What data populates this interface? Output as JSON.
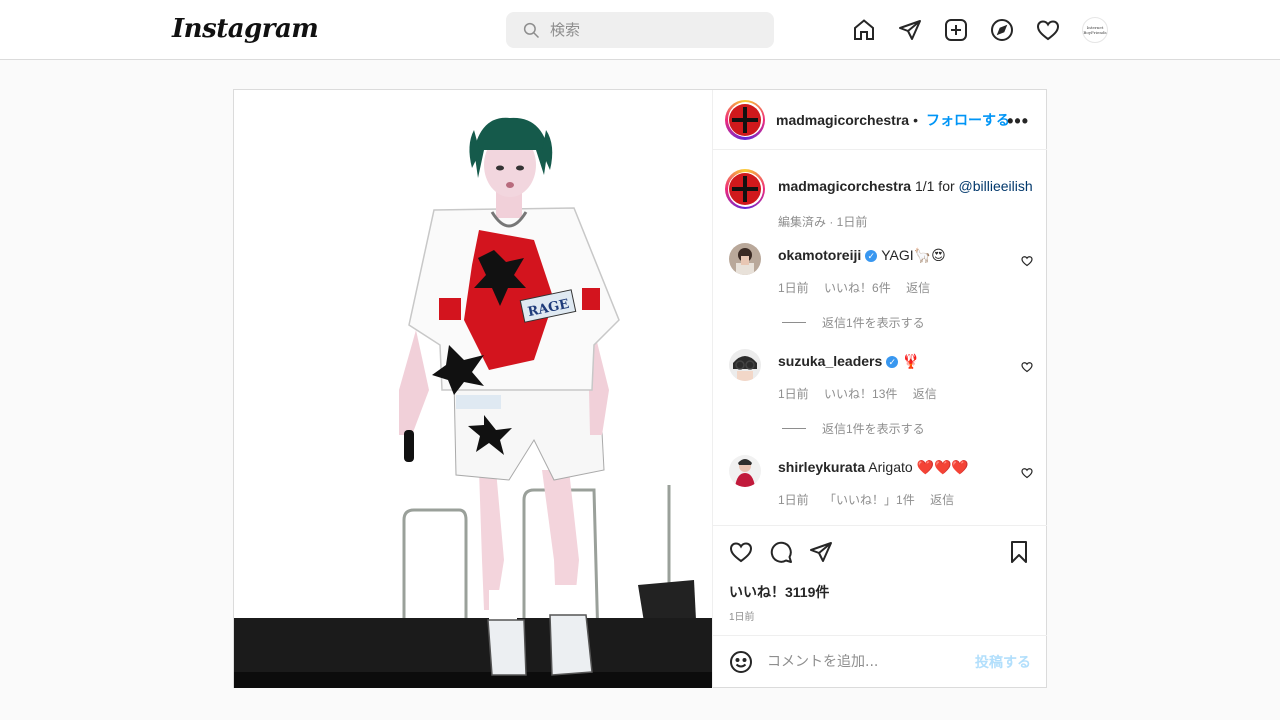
{
  "topbar": {
    "logo": "Instagram",
    "search_placeholder": "検索",
    "avatar_text": "Internet BoyFriends"
  },
  "post": {
    "username": "madmagicorchestra",
    "dot": "•",
    "follow_label": "フォローする",
    "more": "•••",
    "caption": {
      "username": "madmagicorchestra",
      "text": "1/1 for",
      "mention": "@billieeilish",
      "meta": "編集済み · 1日前"
    },
    "comments": [
      {
        "username": "okamotoreiji",
        "verified": true,
        "text": "YAGI🦙😍",
        "time": "1日前",
        "likes": "いいね！6件",
        "reply": "返信",
        "view_replies": "返信1件を表示する"
      },
      {
        "username": "suzuka_leaders",
        "verified": true,
        "text": "🦞",
        "time": "1日前",
        "likes": "いいね！13件",
        "reply": "返信",
        "view_replies": "返信1件を表示する"
      },
      {
        "username": "shirleykurata",
        "verified": false,
        "text": "Arigato ❤️❤️❤️",
        "time": "1日前",
        "likes": "「いいね！」1件",
        "reply": "返信"
      }
    ],
    "likes_count": "いいね！3119件",
    "posted_ago": "1日前",
    "add_comment_placeholder": "コメントを追加...",
    "post_button": "投稿する"
  },
  "colors": {
    "accent": "#0095f6",
    "mention": "#00376b",
    "muted": "#8e8e8e"
  }
}
